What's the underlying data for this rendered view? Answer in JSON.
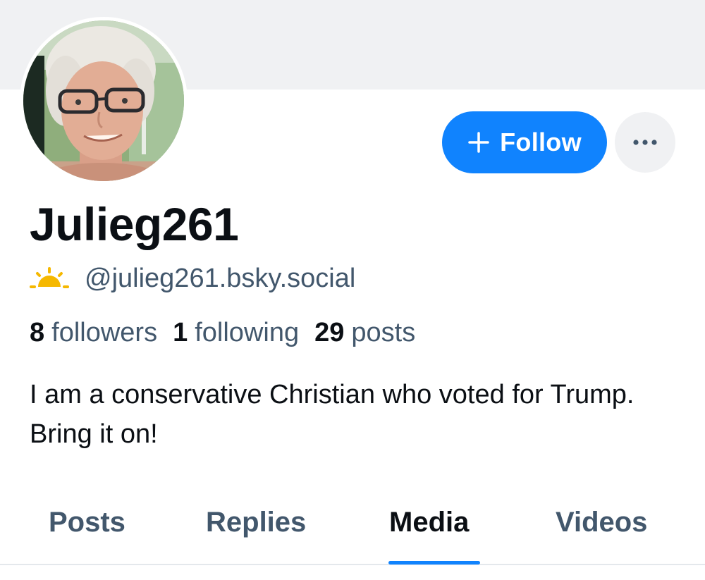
{
  "profile": {
    "display_name": "Julieg261",
    "handle": "@julieg261.bsky.social",
    "handle_icon": "sun-icon",
    "bio": "I am a conservative Christian who voted for Trump. Bring it on!",
    "avatar": "profile-photo"
  },
  "actions": {
    "follow_label": "Follow",
    "follow_icon": "plus-icon",
    "more_icon": "ellipsis-icon"
  },
  "stats": {
    "followers_count": "8",
    "followers_label": "followers",
    "following_count": "1",
    "following_label": "following",
    "posts_count": "29",
    "posts_label": "posts"
  },
  "tabs": [
    {
      "label": "Posts",
      "active": false
    },
    {
      "label": "Replies",
      "active": false
    },
    {
      "label": "Media",
      "active": true
    },
    {
      "label": "Videos",
      "active": false
    }
  ],
  "colors": {
    "accent": "#1083fe",
    "banner": "#f0f1f3",
    "text_primary": "#0b0f14",
    "text_secondary": "#42576c",
    "sun_icon": "#f5b800"
  }
}
